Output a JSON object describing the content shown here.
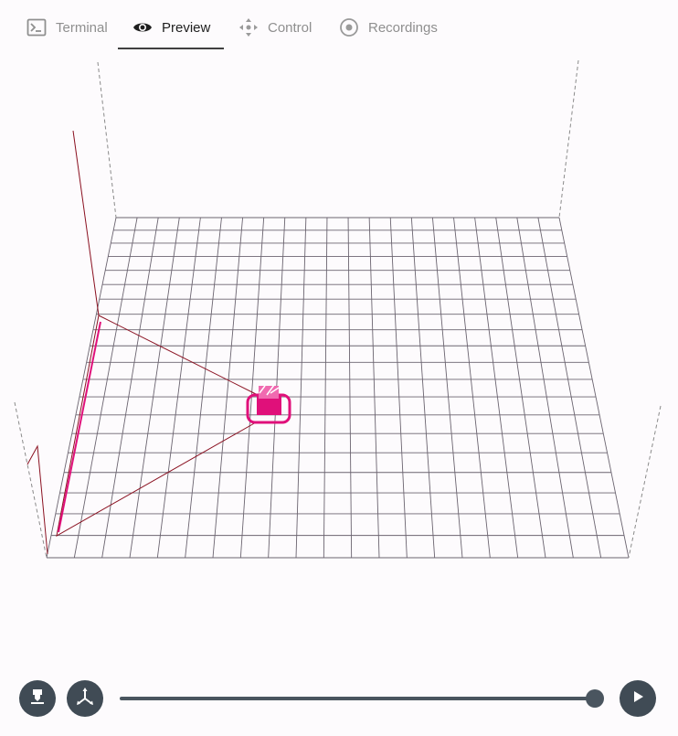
{
  "tabs": [
    {
      "label": "Terminal",
      "icon": "terminal-icon",
      "active": false
    },
    {
      "label": "Preview",
      "icon": "eye-icon",
      "active": true
    },
    {
      "label": "Control",
      "icon": "move-arrows-icon",
      "active": false
    },
    {
      "label": "Recordings",
      "icon": "record-circle-icon",
      "active": false
    }
  ],
  "preview": {
    "grid_color": "#6b6470",
    "travel_color": "#8a1020",
    "extrusion_color": "#e0107a",
    "build_plate": "grid",
    "columns": 21,
    "rows": 20
  },
  "controls": {
    "left_buttons": [
      {
        "name": "extruder-button",
        "icon": "extruder-icon"
      },
      {
        "name": "axes-button",
        "icon": "axes-icon"
      }
    ],
    "layer_slider": {
      "value_fraction": 1.0
    },
    "play_button": {
      "icon": "play-icon"
    },
    "accent": "#404b55"
  }
}
